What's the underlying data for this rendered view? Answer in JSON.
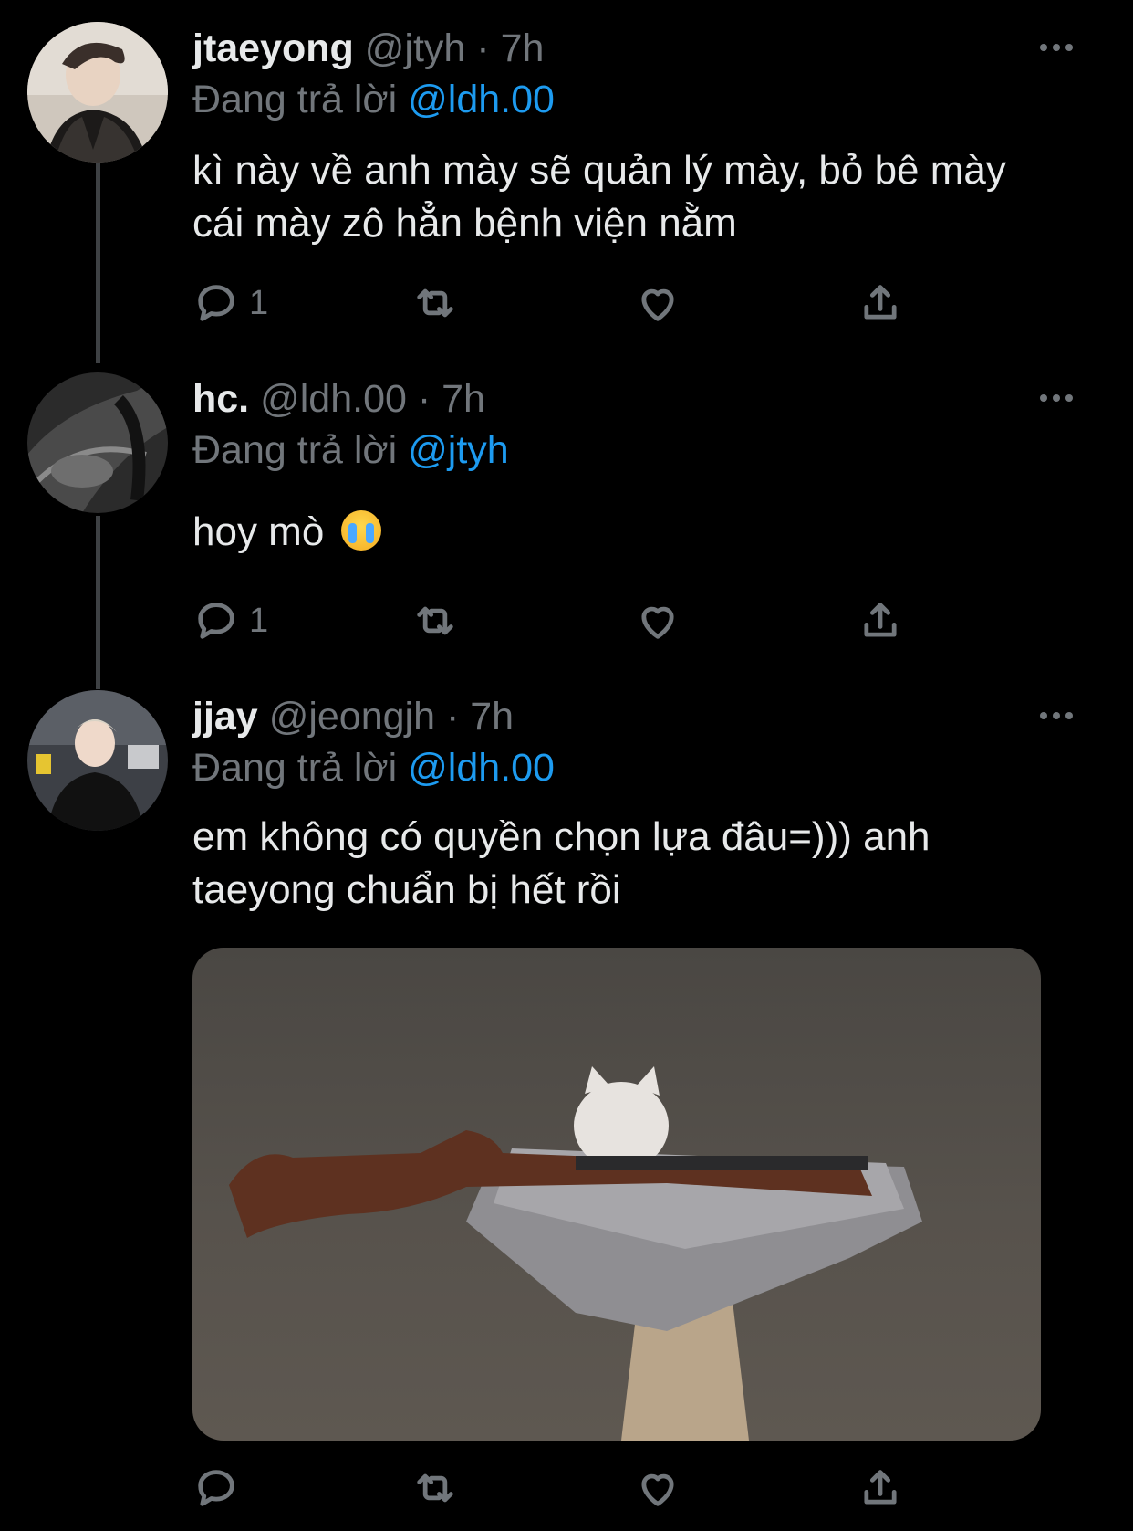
{
  "colors": {
    "background": "#000000",
    "text": "#e7e9ea",
    "muted": "#71767b",
    "accent": "#1d9bf0"
  },
  "tweets": [
    {
      "name": "jtaeyong",
      "handle": "@jtyh",
      "time": "· 7h",
      "replying_prefix": "Đang trả lời",
      "replying_to": "@ldh.00",
      "text": "kì này về anh mày sẽ quản lý mày, bỏ bê mày cái mày zô hẳn bệnh viện nằm",
      "reply_count": "1"
    },
    {
      "name": "hc.",
      "handle": "@ldh.00",
      "time": "· 7h",
      "replying_prefix": "Đang trả lời",
      "replying_to": "@jtyh",
      "text": "hoy mò",
      "reply_count": "1"
    },
    {
      "name": "jjay",
      "handle": "@jeongjh",
      "time": "· 7h",
      "replying_prefix": "Đang trả lời",
      "replying_to": "@ldh.00",
      "text": "em không có quyền chọn lựa đâu=))) anh taeyong chuẩn bị hết rồi",
      "reply_count": ""
    }
  ],
  "icons": {
    "reply": "reply-icon",
    "retweet": "retweet-icon",
    "like": "heart-icon",
    "share": "share-icon",
    "more": "more-icon"
  }
}
